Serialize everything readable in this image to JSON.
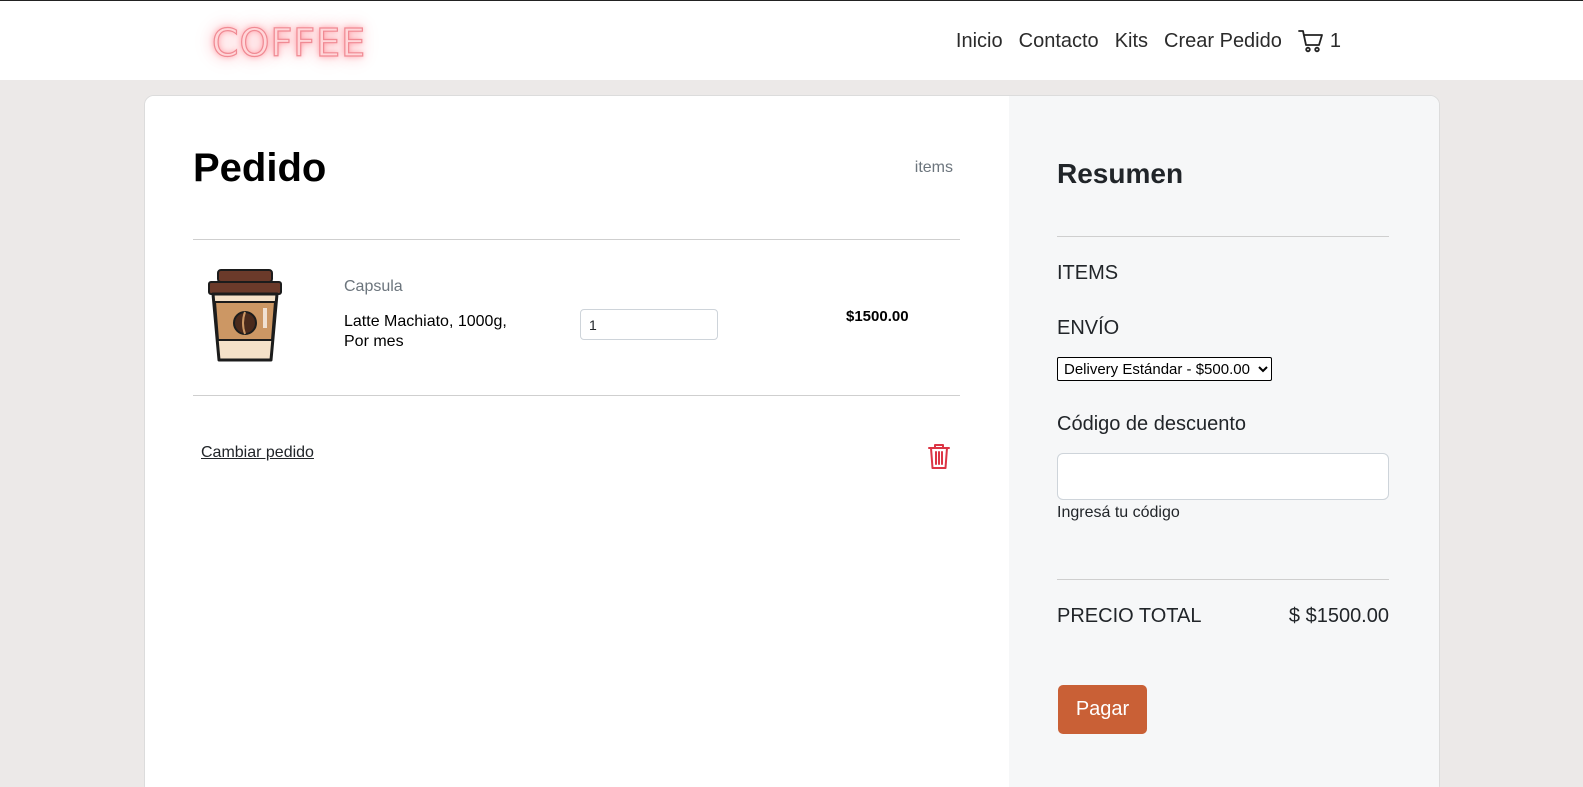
{
  "nav": {
    "logo": "COFFEE",
    "links": [
      "Inicio",
      "Contacto",
      "Kits",
      "Crear Pedido"
    ],
    "cart_count": "1"
  },
  "cart": {
    "title": "Pedido",
    "items_label": "items",
    "item": {
      "category": "Capsula",
      "name": "Latte Machiato, 1000g, Por mes",
      "quantity": "1",
      "price": "$1500.00"
    },
    "change_link": "Cambiar pedido"
  },
  "summary": {
    "title": "Resumen",
    "items_label": "ITEMS",
    "shipping_label": "ENVÍO",
    "shipping_selected": "Delivery Estándar - $500.00",
    "discount_label": "Código de descuento",
    "discount_help": "Ingresá tu código",
    "total_label": "PRECIO TOTAL",
    "total_value": "$ $1500.00",
    "pay_button": "Pagar"
  },
  "colors": {
    "accent": "#c96036",
    "trash": "#dc3545",
    "page_bg": "#ece9e8"
  }
}
